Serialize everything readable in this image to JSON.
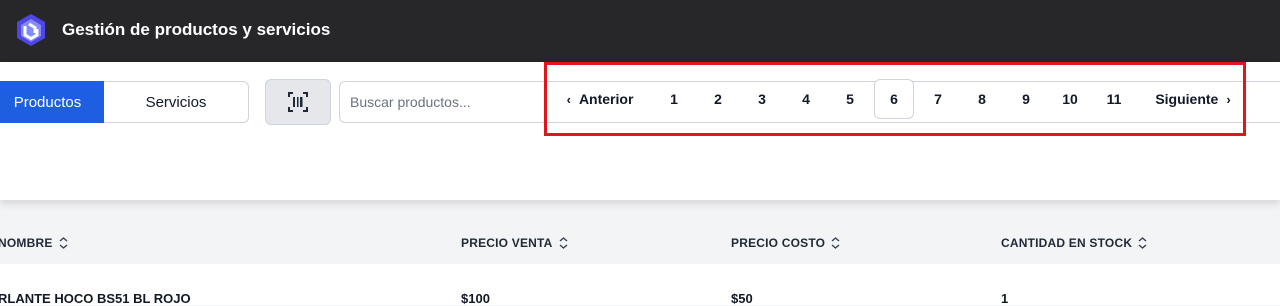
{
  "app": {
    "title": "Gestión de productos y servicios"
  },
  "tabs": {
    "products": "Productos",
    "services": "Servicios"
  },
  "search": {
    "placeholder": "Buscar productos..."
  },
  "pagination": {
    "prev": "Anterior",
    "next": "Siguiente",
    "pages": [
      "1",
      "2",
      "3",
      "4",
      "5",
      "6",
      "7",
      "8",
      "9",
      "10",
      "11"
    ],
    "current": "6"
  },
  "table": {
    "headers": [
      "NOMBRE",
      "PRECIO VENTA",
      "PRECIO COSTO",
      "CANTIDAD EN STOCK"
    ],
    "rows": [
      [
        "RLANTE HOCO BS51 BL ROJO",
        "$100",
        "$50",
        "1"
      ]
    ]
  },
  "colors": {
    "topbar": "#27272a",
    "accent": "#1d5fe0",
    "highlight": "#e0161e"
  }
}
